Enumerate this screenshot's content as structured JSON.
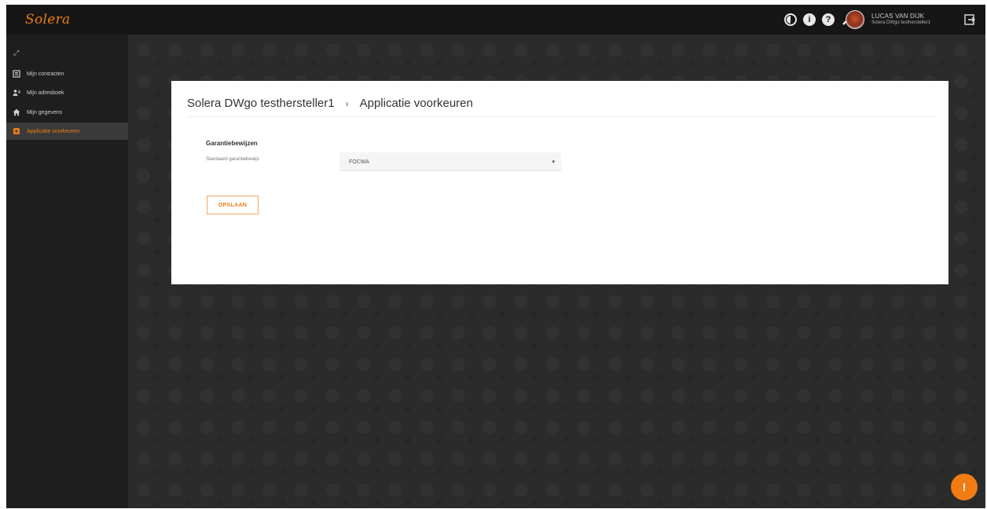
{
  "brand": {
    "logo_text": "Solera",
    "accent_color": "#f07c13"
  },
  "topbar": {
    "icons": [
      "contrast-icon",
      "info-icon",
      "help-icon",
      "wrench-icon"
    ],
    "user": {
      "name": "LUCAS VAN DIJK",
      "company": "Solera DWgo testhersteller1"
    }
  },
  "sidebar": {
    "collapse_glyph": "⤢",
    "items": [
      {
        "label": "Mijn contracten",
        "icon": "contracts-icon",
        "active": false
      },
      {
        "label": "Mijn adresboek",
        "icon": "address-book-icon",
        "active": false
      },
      {
        "label": "Mijn gegevens",
        "icon": "home-icon",
        "active": false
      },
      {
        "label": "Applicatie voorkeuren",
        "icon": "settings-icon",
        "active": true
      }
    ]
  },
  "main": {
    "breadcrumb": {
      "parent": "Solera DWgo testhersteller1",
      "separator": "›",
      "current": "Applicatie voorkeuren"
    },
    "section_title": "Garantiebewijzen",
    "field": {
      "label": "Standaard garantiebewijs",
      "value": "FOCWA"
    },
    "save_label": "OPSLAAN",
    "fab_label": "!"
  }
}
